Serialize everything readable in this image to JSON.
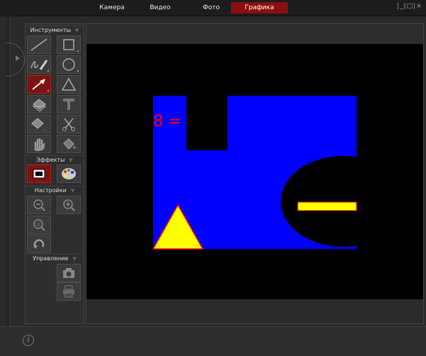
{
  "menu": {
    "items": [
      {
        "label": "Камера",
        "active": false
      },
      {
        "label": "Видео",
        "active": false
      },
      {
        "label": "Фото",
        "active": false
      },
      {
        "label": "Графика",
        "active": true
      }
    ],
    "window_controls": "|_|□|×"
  },
  "sections": {
    "tools": "Инструменты",
    "effects": "Эффекты",
    "settings": "Настройки",
    "control": "Управление"
  },
  "tools": [
    {
      "name": "line-icon"
    },
    {
      "name": "rectangle-icon"
    },
    {
      "name": "freehand-pencil-icon"
    },
    {
      "name": "ellipse-icon"
    },
    {
      "name": "arrow-icon",
      "active": true
    },
    {
      "name": "triangle-icon"
    },
    {
      "name": "eraser-icon"
    },
    {
      "name": "text-icon"
    },
    {
      "name": "eraser-partial-icon"
    },
    {
      "name": "scissors-icon"
    },
    {
      "name": "hand-icon"
    },
    {
      "name": "fill-bucket-icon"
    }
  ],
  "effects": [
    {
      "name": "frame-icon",
      "active": true
    },
    {
      "name": "palette-icon"
    }
  ],
  "settings": [
    {
      "name": "zoom-out-icon"
    },
    {
      "name": "zoom-in-icon"
    },
    {
      "name": "zoom-actual-icon",
      "label": "1X"
    },
    {
      "name": "rotate-icon"
    }
  ],
  "control": [
    {
      "name": "camera-icon"
    },
    {
      "name": "printer-icon"
    }
  ],
  "canvas": {
    "annotation_text": "8 =",
    "colors": {
      "background": "#000000",
      "blue": "#0000ff",
      "red": "#ff0000",
      "yellow": "#ffff00",
      "accent": "#8a1010"
    }
  },
  "status": {
    "info_icon": "i"
  }
}
